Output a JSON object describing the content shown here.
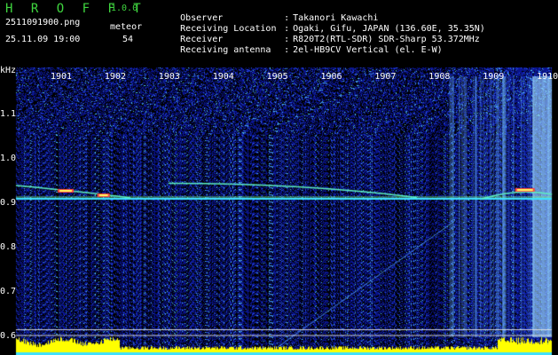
{
  "app": {
    "title": "H R O F F T",
    "version": "1.0.0"
  },
  "file": {
    "name": "2511091900.png",
    "datetime": "25.11.09 19:00"
  },
  "meteor": {
    "label": "meteor",
    "count": "54"
  },
  "info": [
    {
      "key": "Observer",
      "value": "Takanori Kawachi"
    },
    {
      "key": "Receiving Location",
      "value": "Ogaki, Gifu, JAPAN (136.60E, 35.35N)"
    },
    {
      "key": "Receiver",
      "value": "R820T2(RTL-SDR) SDR-Sharp 53.372MHz"
    },
    {
      "key": "Receiving antenna",
      "value": "2el-HB9CV Vertical (el. E-W)"
    }
  ],
  "colors": {
    "title_green": "#3fd63f",
    "background": "#000000",
    "noise_blue": "#0a1a8c",
    "signal_yellow": "#ffff00"
  },
  "chart_data": {
    "type": "heatmap",
    "ylabel": "kHz",
    "ylim": [
      0.58,
      1.17
    ],
    "yticks": [
      "1.1",
      "1.0",
      "0.9",
      "0.8",
      "0.7",
      "0.6"
    ],
    "yvals": [
      1.1,
      1.0,
      0.9,
      0.8,
      0.7,
      0.6
    ],
    "xlim": [
      1900,
      1910.2
    ],
    "xticks": [
      "1901",
      "1902",
      "1903",
      "1904",
      "1905",
      "1906",
      "1907",
      "1908",
      "1909",
      "1910"
    ],
    "xvals": [
      1901,
      1902,
      1903,
      1904,
      1905,
      1906,
      1907,
      1908,
      1909,
      1910
    ],
    "carrier_khz": 0.91,
    "guide_lines_khz": [
      0.615,
      0.602
    ]
  }
}
